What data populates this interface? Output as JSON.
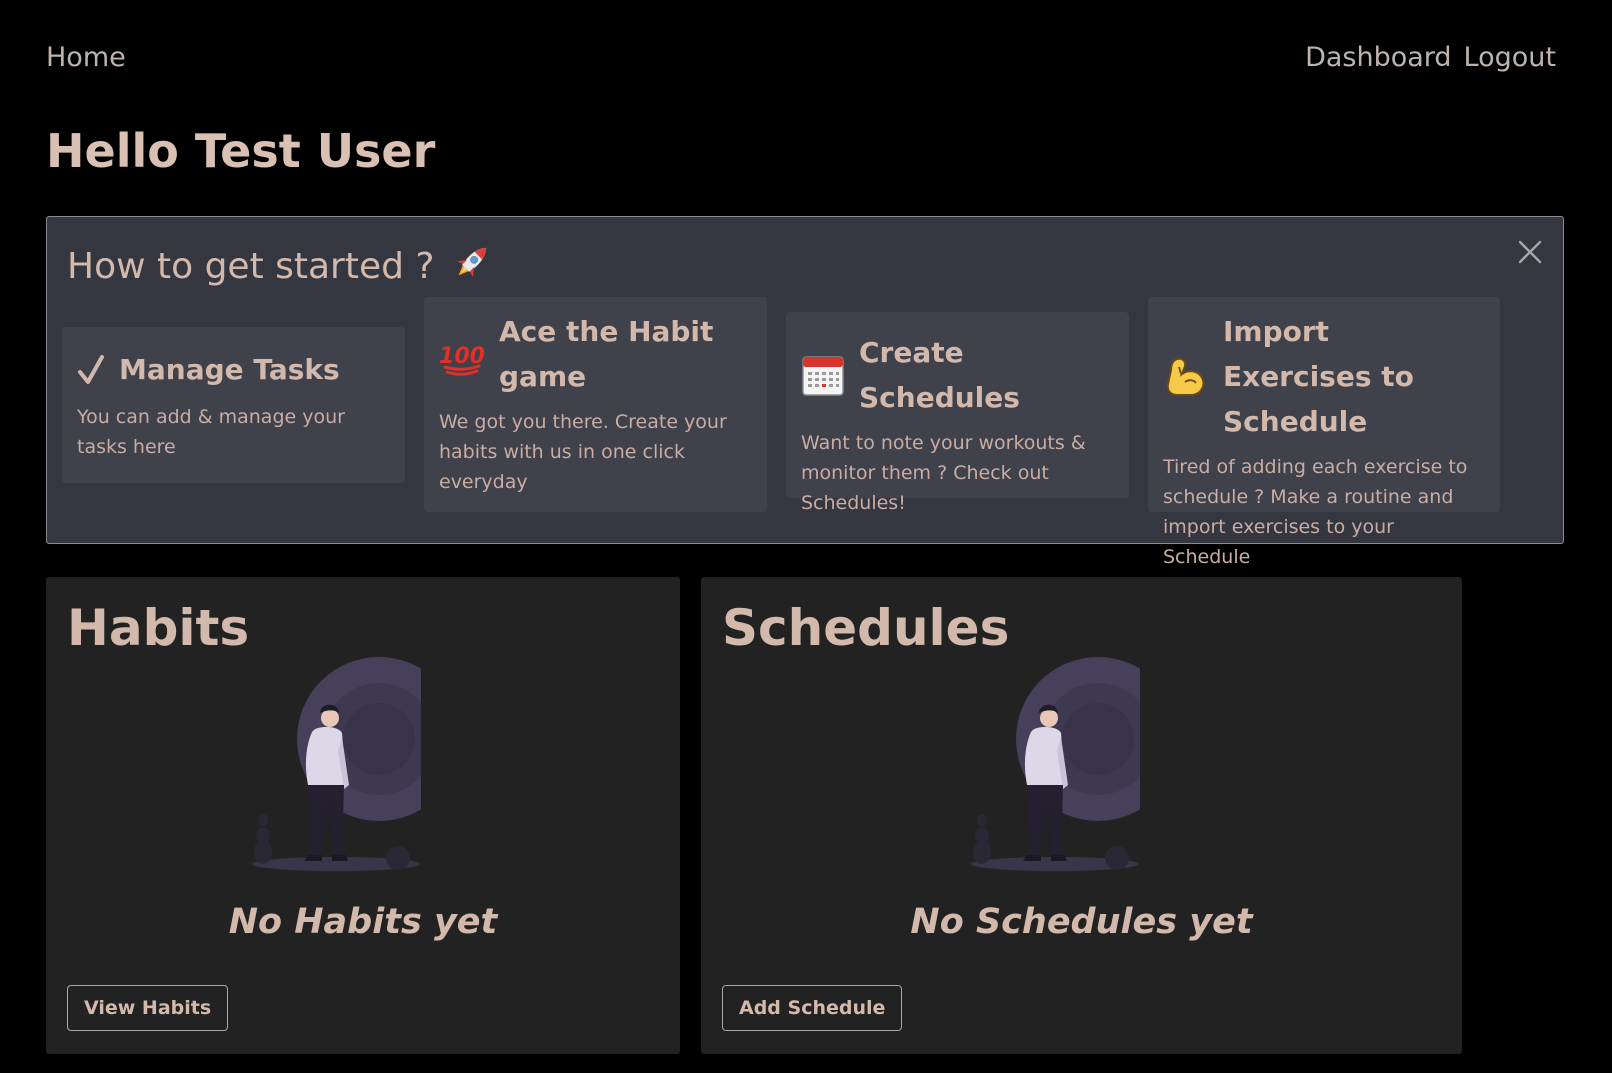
{
  "nav": {
    "home": "Home",
    "dashboard": "Dashboard",
    "logout": "Logout"
  },
  "greeting": "Hello Test User",
  "get_started": {
    "title": "How to get started ?",
    "title_icon": "rocket-icon",
    "close_icon": "close-icon",
    "cards": [
      {
        "icon": "checkmark-icon",
        "title": "Manage Tasks",
        "description": "You can add & manage your tasks here"
      },
      {
        "icon": "hundred-points-icon",
        "title": "Ace the Habit game",
        "description": "We got you there. Create your habits with us in one click everyday"
      },
      {
        "icon": "calendar-icon",
        "title": "Create Schedules",
        "description": "Want to note your workouts & monitor them ? Check out Schedules!"
      },
      {
        "icon": "flexed-biceps-icon",
        "title": "Import Exercises to Schedule",
        "description": "Tired of adding each exercise to schedule ? Make a routine and import exercises to your Schedule"
      }
    ]
  },
  "habits": {
    "title": "Habits",
    "empty_text": "No Habits yet",
    "button": "View Habits"
  },
  "schedules": {
    "title": "Schedules",
    "empty_text": "No Schedules yet",
    "button": "Add Schedule"
  },
  "colors": {
    "background": "#000000",
    "accent_text": "#d3b9ab",
    "banner": "#353740",
    "card": "#3f414b",
    "panel": "#222222",
    "illustration_circle": "#46405a"
  }
}
